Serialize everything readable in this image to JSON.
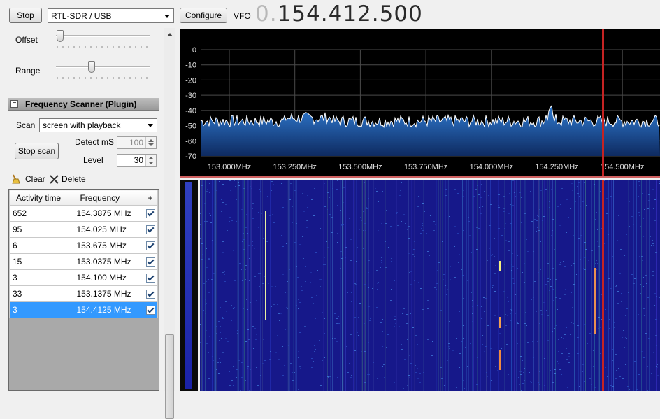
{
  "toolbar": {
    "stop_label": "Stop",
    "source_value": "RTL-SDR / USB",
    "configure_label": "Configure",
    "vfo_label": "VFO",
    "vfo_dim": "0.",
    "vfo_value": "154.412.500"
  },
  "audio": {
    "offset_label": "Offset",
    "range_label": "Range",
    "offset_level": 0.02,
    "range_level": 0.38
  },
  "scanner": {
    "header": "Frequency Scanner (Plugin)",
    "collapse_symbol": "−",
    "scan_label": "Scan",
    "scan_mode": "screen with playback",
    "stop_scan_label": "Stop scan",
    "detect_label": "Detect mS",
    "detect_value": "100",
    "level_label": "Level",
    "level_value": "30",
    "clear_label": "Clear",
    "delete_label": "Delete",
    "columns": [
      "Activity time",
      "Frequency",
      "+"
    ],
    "rows": [
      {
        "time": "652",
        "freq": "154.3875 MHz",
        "checked": true,
        "selected": false
      },
      {
        "time": "95",
        "freq": "154.025 MHz",
        "checked": true,
        "selected": false
      },
      {
        "time": "6",
        "freq": "153.675 MHz",
        "checked": true,
        "selected": false
      },
      {
        "time": "15",
        "freq": "153.0375 MHz",
        "checked": true,
        "selected": false
      },
      {
        "time": "3",
        "freq": "154.100 MHz",
        "checked": true,
        "selected": false
      },
      {
        "time": "33",
        "freq": "153.1375 MHz",
        "checked": true,
        "selected": false
      },
      {
        "time": "3",
        "freq": "154.4125 MHz",
        "checked": true,
        "selected": true
      }
    ]
  },
  "spectrum": {
    "y_ticks": [
      "0",
      "-10",
      "-20",
      "-30",
      "-40",
      "-50",
      "-60",
      "-70"
    ],
    "x_ticks": [
      "153.000MHz",
      "153.250MHz",
      "153.500MHz",
      "153.750MHz",
      "154.000MHz",
      "154.250MHz",
      "154.500MHz"
    ],
    "ylim": [
      -70,
      0
    ],
    "noise_floor": -47
  },
  "colors": {
    "spectrum_bg": "#000000",
    "spectrum_fill": "#1f5fb0",
    "waterfall_bg": "#16188a",
    "marker": "#d02020",
    "selection": "#3399ff"
  }
}
